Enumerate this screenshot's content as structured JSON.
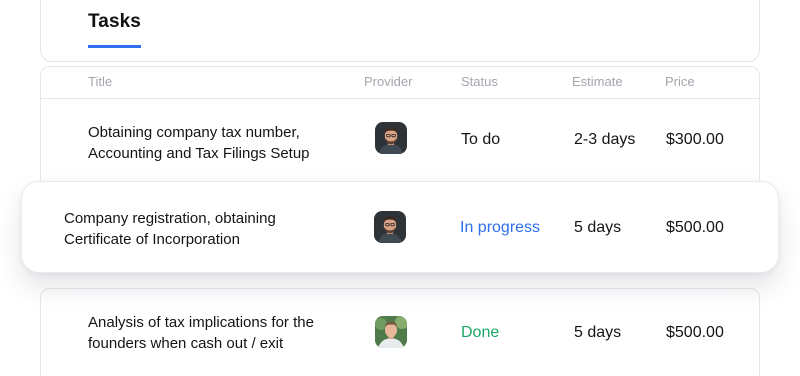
{
  "tab": {
    "label": "Tasks"
  },
  "columns": {
    "title": "Title",
    "provider": "Provider",
    "status": "Status",
    "estimate": "Estimate",
    "price": "Price"
  },
  "rows": [
    {
      "title_line1": "Obtaining company tax number,",
      "title_line2": "Accounting and Tax Filings Setup",
      "provider_avatar": "avatar-man-dark",
      "status": "To do",
      "status_color": "#141414",
      "estimate": "2-3 days",
      "price": "$300.00"
    },
    {
      "title_line1": "Company registration, obtaining",
      "title_line2": "Certificate of Incorporation",
      "provider_avatar": "avatar-man-dark",
      "status": "In progress",
      "status_color": "#2f6fed",
      "estimate": "5 days",
      "price": "$500.00"
    },
    {
      "title_line1": "Analysis of tax implications for the",
      "title_line2": "founders when cash out / exit",
      "provider_avatar": "avatar-man-light",
      "status": "Done",
      "status_color": "#19a866",
      "estimate": "5 days",
      "price": "$500.00"
    }
  ],
  "colors": {
    "accent": "#2f6fed",
    "in_progress": "#2f6fed",
    "done": "#19a866",
    "muted": "#a2a6ad",
    "border": "#e4e6ea"
  }
}
